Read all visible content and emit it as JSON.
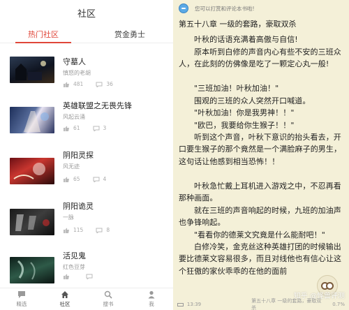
{
  "left": {
    "title": "社区",
    "tabs": [
      {
        "label": "热门社区",
        "active": true
      },
      {
        "label": "赏金勇士",
        "active": false
      }
    ],
    "items": [
      {
        "title": "守墓人",
        "author": "慎怒的老胡",
        "likes": "481",
        "comments": "36"
      },
      {
        "title": "英雄联盟之无畏先锋",
        "author": "风起云涌",
        "likes": "61",
        "comments": "3"
      },
      {
        "title": "阴阳灵探",
        "author": "风无迹",
        "likes": "65",
        "comments": "4"
      },
      {
        "title": "阴阳诡灵",
        "author": "一脉",
        "likes": "115",
        "comments": "8"
      },
      {
        "title": "活见鬼",
        "author": "红色豆芽",
        "likes": "",
        "comments": ""
      }
    ],
    "nav": [
      {
        "label": "精选",
        "icon": "chat-icon"
      },
      {
        "label": "社区",
        "icon": "home-icon",
        "active": true
      },
      {
        "label": "搜书",
        "icon": "search-icon"
      },
      {
        "label": "我",
        "icon": "person-icon"
      }
    ]
  },
  "right": {
    "banner": "您可以打赏和评论本书啦!",
    "chapter_title": "第五十八章 一级的套路，豪取双杀",
    "paragraphs": [
      "叶秋的话语充满着高傲与自信!",
      "原本听到白修的声音内心有些不安的三班众人，在此刻的仿佛像是吃了一颗定心丸一般!",
      "\"三班加油！叶秋加油！\"",
      "围观的三班的众人突然开口喊道。",
      "\"叶秋加油！你是我男神！！\"",
      "\"欧巴，我要给你生猴子！！\"",
      "听到这个声音，叶秋下意识的抬头看去，开口要生猴子的那个竟然是一个满脸麻子的男生，这句话让他感到相当恐怖！！",
      "叶秋急忙戴上耳机进入游戏之中，不忍再看那种画面。",
      "就在三班的声音响起的时候，九班的加油声也争锋响起。",
      "\"看看你的德莱文究竟是什么能耐吧！\"",
      "白修冷笑，金克丝这种英雄打团的时候输出要比德莱文容易很多，而且对线他也有信心让这个狂傲的家伙乖乖的在他的面前"
    ],
    "footer": {
      "time": "13:39",
      "chapter": "第五十八章 一级的套路，豪取双杀",
      "percent": "0.7%"
    },
    "watermark": "知乎 @怪兽评测"
  },
  "colors": {
    "accent": "#e0473a",
    "reader_bg": "#f4f0d8"
  }
}
